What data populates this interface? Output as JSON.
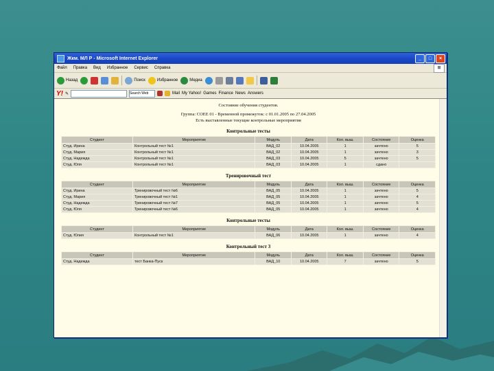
{
  "window": {
    "title": "Жкм. МЛ Р - Microsoft Internet Explorer"
  },
  "menu": [
    "Файл",
    "Правка",
    "Вид",
    "Избранное",
    "Сервис",
    "Справка"
  ],
  "toolbar": {
    "back": "Назад",
    "search": "Поиск",
    "favorites": "Избранное",
    "media": "Медиа"
  },
  "linksbar": {
    "yahoo": "Y!",
    "search_btn": "Search Web",
    "mail": "Mail",
    "my_yahoo": "My Yahoo!",
    "games": "Games",
    "finance": "Finance",
    "news": "News",
    "answers": "Answers"
  },
  "page": {
    "heading": "Состояние обучения студентов.",
    "group_line": "Группа: СОЕЕ 01 - Временной промежуток: с 01.01.2005 по 27.04.2005",
    "filter_line": "Есть выставленные текущие контрольные мероприятия",
    "columns": [
      "Студент",
      "Мероприятие",
      "Модуль",
      "Дата",
      "Кол. выш.",
      "Состояние",
      "Оценка"
    ],
    "sections": [
      {
        "title": "Контрольные тесты",
        "rows": [
          [
            "Студ. Ирина",
            "Контрольный тест №1",
            "ВАД_02",
            "10.04.2005",
            "1",
            "зачтено",
            "5"
          ],
          [
            "Студ. Мария",
            "Контрольный тест №1",
            "ВАД_02",
            "10.04.2005",
            "1",
            "зачтено",
            "3"
          ],
          [
            "Студ. Надежда",
            "Контрольный тест №1",
            "ВАД_03",
            "10.04.2005",
            "5",
            "зачтено",
            "5"
          ],
          [
            "Студ. Юля",
            "Контрольный тест №1",
            "ВАД_03",
            "10.04.2005",
            "1",
            "сдано",
            ""
          ]
        ]
      },
      {
        "title": "Тренировочный тест",
        "rows": [
          [
            "Студ. Ирина",
            "Тренировочный тест №6",
            "ВАД_05",
            "10.04.2005",
            "1",
            "зачтено",
            "5"
          ],
          [
            "Студ. Мария",
            "Тренировочный тест №1",
            "ВАД_05",
            "10.04.2005",
            "1",
            "зачтено",
            "4"
          ],
          [
            "Студ. Надежда",
            "Тренировочный тест №7",
            "ВАД_05",
            "10.04.2005",
            "1",
            "зачтено",
            "5"
          ],
          [
            "Студ. Юля",
            "Тренировочный тест №6",
            "ВАД_05",
            "10.04.2005",
            "1",
            "зачтено",
            "4"
          ]
        ]
      },
      {
        "title": "Контрольные тесты",
        "rows": [
          [
            "Студ. Юлия",
            "Контрольный тест №1",
            "ВАД_06",
            "10.04.2005",
            "1",
            "зачтено",
            "4"
          ]
        ]
      },
      {
        "title": "Контрольный тест 3",
        "rows": [
          [
            "Студ. Надежда",
            "тест Банка-Пуск",
            "ВАД_10",
            "10.04.2005",
            "7",
            "зачтено",
            "5"
          ]
        ]
      }
    ]
  }
}
